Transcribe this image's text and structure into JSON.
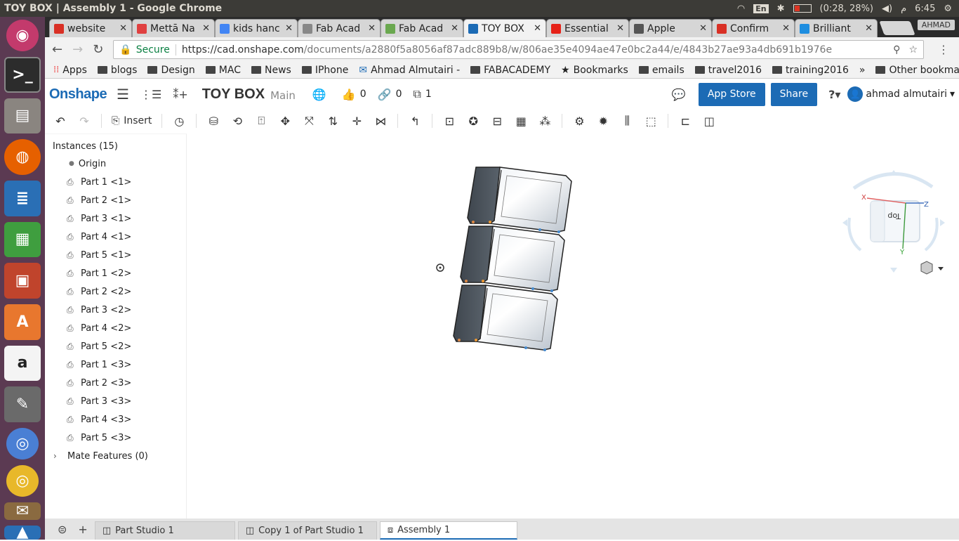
{
  "os": {
    "window_title": "TOY BOX | Assembly 1 - Google Chrome",
    "keyboard": "En",
    "battery": "(0:28, 28%)",
    "battery_percent": 28,
    "am_pm": "م",
    "time": "6:45",
    "launcher_apps": [
      "ubuntu-dash",
      "terminal",
      "files",
      "firefox",
      "writer",
      "calc",
      "impress",
      "software-center",
      "amazon",
      "system-settings",
      "chromium",
      "chrome",
      "mail-app",
      "vlc"
    ]
  },
  "tabs": [
    {
      "title": "website",
      "icon": "gmail-icon",
      "color": "#d93025"
    },
    {
      "title": "Mettā Na",
      "icon": "red-square-icon",
      "color": "#e04040"
    },
    {
      "title": "kids hanc",
      "icon": "google-icon",
      "color": "#4285f4"
    },
    {
      "title": "Fab Acad",
      "icon": "page-icon",
      "color": "#888888"
    },
    {
      "title": "Fab Acad",
      "icon": "fab-icon",
      "color": "#6aa84f"
    },
    {
      "title": "TOY BOX",
      "icon": "onshape-icon",
      "color": "#1c6bb5"
    },
    {
      "title": "Essential",
      "icon": "youtube-icon",
      "color": "#e62117"
    },
    {
      "title": "Apple",
      "icon": "apple-icon",
      "color": "#555555"
    },
    {
      "title": "Confirm",
      "icon": "gmail-icon",
      "color": "#d93025"
    },
    {
      "title": "Brilliant",
      "icon": "brilliant-icon",
      "color": "#1e8ee0"
    }
  ],
  "profile_name": "AHMAD",
  "address": {
    "secure_label": "Secure",
    "url_domain": "https://cad.onshape.com",
    "url_path": "/documents/a2880f5a8056af87adc889b8/w/806ae35e4094ae47e0bc2a44/e/4843b27ae93a4db691b1976e"
  },
  "bookmarks": [
    {
      "label": "Apps",
      "icon": "apps-grid-icon"
    },
    {
      "label": "blogs",
      "icon": "folder-icon"
    },
    {
      "label": "Design",
      "icon": "folder-icon"
    },
    {
      "label": "MAC",
      "icon": "folder-icon"
    },
    {
      "label": "News",
      "icon": "folder-icon"
    },
    {
      "label": "IPhone",
      "icon": "folder-icon"
    },
    {
      "label": "Ahmad Almutairi -",
      "icon": "mail-icon"
    },
    {
      "label": "FABACADEMY",
      "icon": "folder-icon"
    },
    {
      "label": "Bookmarks",
      "icon": "star-icon"
    },
    {
      "label": "emails",
      "icon": "folder-icon"
    },
    {
      "label": "travel2016",
      "icon": "folder-icon"
    },
    {
      "label": "training2016",
      "icon": "folder-icon"
    }
  ],
  "bookmarks_overflow": "»",
  "other_bookmarks": "Other bookmarks",
  "onshape": {
    "logo": "Onshape",
    "doc_name": "TOY BOX",
    "branch": "Main",
    "likes": "0",
    "links": "0",
    "versions": "1",
    "app_store": "App Store",
    "share": "Share",
    "help": "?",
    "user_name": "ahmad almutairi"
  },
  "toolbar": {
    "insert_label": "Insert"
  },
  "panel": {
    "header": "Instances (15)",
    "origin": "Origin",
    "parts": [
      "Part 1 <1>",
      "Part 2 <1>",
      "Part 3 <1>",
      "Part 4 <1>",
      "Part 5 <1>",
      "Part 1 <2>",
      "Part 2 <2>",
      "Part 3 <2>",
      "Part 4 <2>",
      "Part 5 <2>",
      "Part 1 <3>",
      "Part 2 <3>",
      "Part 3 <3>",
      "Part 4 <3>",
      "Part 5 <3>"
    ],
    "mate_features": "Mate Features (0)"
  },
  "viewcube": {
    "x_label": "X",
    "y_label": "Y",
    "z_label": "Z",
    "face_label": "Top"
  },
  "bottom_tabs": [
    {
      "label": "Part Studio 1",
      "active": false
    },
    {
      "label": "Copy 1 of Part Studio 1",
      "active": false
    },
    {
      "label": "Assembly 1",
      "active": true
    }
  ]
}
